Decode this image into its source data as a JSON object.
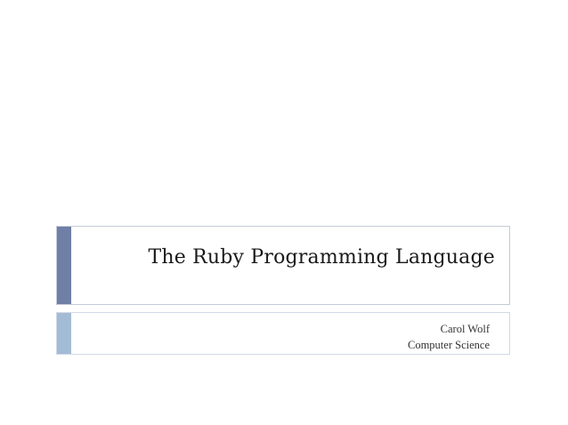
{
  "slide": {
    "title": "The Ruby Programming Language",
    "subtitle_lines": [
      "Carol Wolf",
      "Computer Science"
    ]
  }
}
